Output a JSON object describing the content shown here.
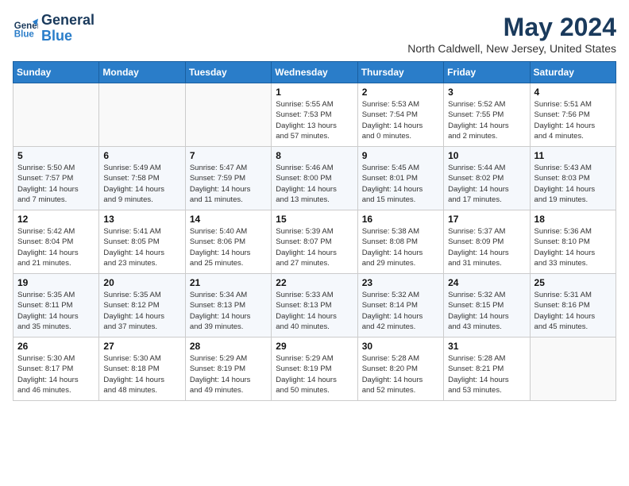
{
  "header": {
    "logo_line1": "General",
    "logo_line2": "Blue",
    "title": "May 2024",
    "subtitle": "North Caldwell, New Jersey, United States"
  },
  "weekdays": [
    "Sunday",
    "Monday",
    "Tuesday",
    "Wednesday",
    "Thursday",
    "Friday",
    "Saturday"
  ],
  "weeks": [
    [
      {
        "day": "",
        "info": ""
      },
      {
        "day": "",
        "info": ""
      },
      {
        "day": "",
        "info": ""
      },
      {
        "day": "1",
        "info": "Sunrise: 5:55 AM\nSunset: 7:53 PM\nDaylight: 13 hours\nand 57 minutes."
      },
      {
        "day": "2",
        "info": "Sunrise: 5:53 AM\nSunset: 7:54 PM\nDaylight: 14 hours\nand 0 minutes."
      },
      {
        "day": "3",
        "info": "Sunrise: 5:52 AM\nSunset: 7:55 PM\nDaylight: 14 hours\nand 2 minutes."
      },
      {
        "day": "4",
        "info": "Sunrise: 5:51 AM\nSunset: 7:56 PM\nDaylight: 14 hours\nand 4 minutes."
      }
    ],
    [
      {
        "day": "5",
        "info": "Sunrise: 5:50 AM\nSunset: 7:57 PM\nDaylight: 14 hours\nand 7 minutes."
      },
      {
        "day": "6",
        "info": "Sunrise: 5:49 AM\nSunset: 7:58 PM\nDaylight: 14 hours\nand 9 minutes."
      },
      {
        "day": "7",
        "info": "Sunrise: 5:47 AM\nSunset: 7:59 PM\nDaylight: 14 hours\nand 11 minutes."
      },
      {
        "day": "8",
        "info": "Sunrise: 5:46 AM\nSunset: 8:00 PM\nDaylight: 14 hours\nand 13 minutes."
      },
      {
        "day": "9",
        "info": "Sunrise: 5:45 AM\nSunset: 8:01 PM\nDaylight: 14 hours\nand 15 minutes."
      },
      {
        "day": "10",
        "info": "Sunrise: 5:44 AM\nSunset: 8:02 PM\nDaylight: 14 hours\nand 17 minutes."
      },
      {
        "day": "11",
        "info": "Sunrise: 5:43 AM\nSunset: 8:03 PM\nDaylight: 14 hours\nand 19 minutes."
      }
    ],
    [
      {
        "day": "12",
        "info": "Sunrise: 5:42 AM\nSunset: 8:04 PM\nDaylight: 14 hours\nand 21 minutes."
      },
      {
        "day": "13",
        "info": "Sunrise: 5:41 AM\nSunset: 8:05 PM\nDaylight: 14 hours\nand 23 minutes."
      },
      {
        "day": "14",
        "info": "Sunrise: 5:40 AM\nSunset: 8:06 PM\nDaylight: 14 hours\nand 25 minutes."
      },
      {
        "day": "15",
        "info": "Sunrise: 5:39 AM\nSunset: 8:07 PM\nDaylight: 14 hours\nand 27 minutes."
      },
      {
        "day": "16",
        "info": "Sunrise: 5:38 AM\nSunset: 8:08 PM\nDaylight: 14 hours\nand 29 minutes."
      },
      {
        "day": "17",
        "info": "Sunrise: 5:37 AM\nSunset: 8:09 PM\nDaylight: 14 hours\nand 31 minutes."
      },
      {
        "day": "18",
        "info": "Sunrise: 5:36 AM\nSunset: 8:10 PM\nDaylight: 14 hours\nand 33 minutes."
      }
    ],
    [
      {
        "day": "19",
        "info": "Sunrise: 5:35 AM\nSunset: 8:11 PM\nDaylight: 14 hours\nand 35 minutes."
      },
      {
        "day": "20",
        "info": "Sunrise: 5:35 AM\nSunset: 8:12 PM\nDaylight: 14 hours\nand 37 minutes."
      },
      {
        "day": "21",
        "info": "Sunrise: 5:34 AM\nSunset: 8:13 PM\nDaylight: 14 hours\nand 39 minutes."
      },
      {
        "day": "22",
        "info": "Sunrise: 5:33 AM\nSunset: 8:13 PM\nDaylight: 14 hours\nand 40 minutes."
      },
      {
        "day": "23",
        "info": "Sunrise: 5:32 AM\nSunset: 8:14 PM\nDaylight: 14 hours\nand 42 minutes."
      },
      {
        "day": "24",
        "info": "Sunrise: 5:32 AM\nSunset: 8:15 PM\nDaylight: 14 hours\nand 43 minutes."
      },
      {
        "day": "25",
        "info": "Sunrise: 5:31 AM\nSunset: 8:16 PM\nDaylight: 14 hours\nand 45 minutes."
      }
    ],
    [
      {
        "day": "26",
        "info": "Sunrise: 5:30 AM\nSunset: 8:17 PM\nDaylight: 14 hours\nand 46 minutes."
      },
      {
        "day": "27",
        "info": "Sunrise: 5:30 AM\nSunset: 8:18 PM\nDaylight: 14 hours\nand 48 minutes."
      },
      {
        "day": "28",
        "info": "Sunrise: 5:29 AM\nSunset: 8:19 PM\nDaylight: 14 hours\nand 49 minutes."
      },
      {
        "day": "29",
        "info": "Sunrise: 5:29 AM\nSunset: 8:19 PM\nDaylight: 14 hours\nand 50 minutes."
      },
      {
        "day": "30",
        "info": "Sunrise: 5:28 AM\nSunset: 8:20 PM\nDaylight: 14 hours\nand 52 minutes."
      },
      {
        "day": "31",
        "info": "Sunrise: 5:28 AM\nSunset: 8:21 PM\nDaylight: 14 hours\nand 53 minutes."
      },
      {
        "day": "",
        "info": ""
      }
    ]
  ]
}
